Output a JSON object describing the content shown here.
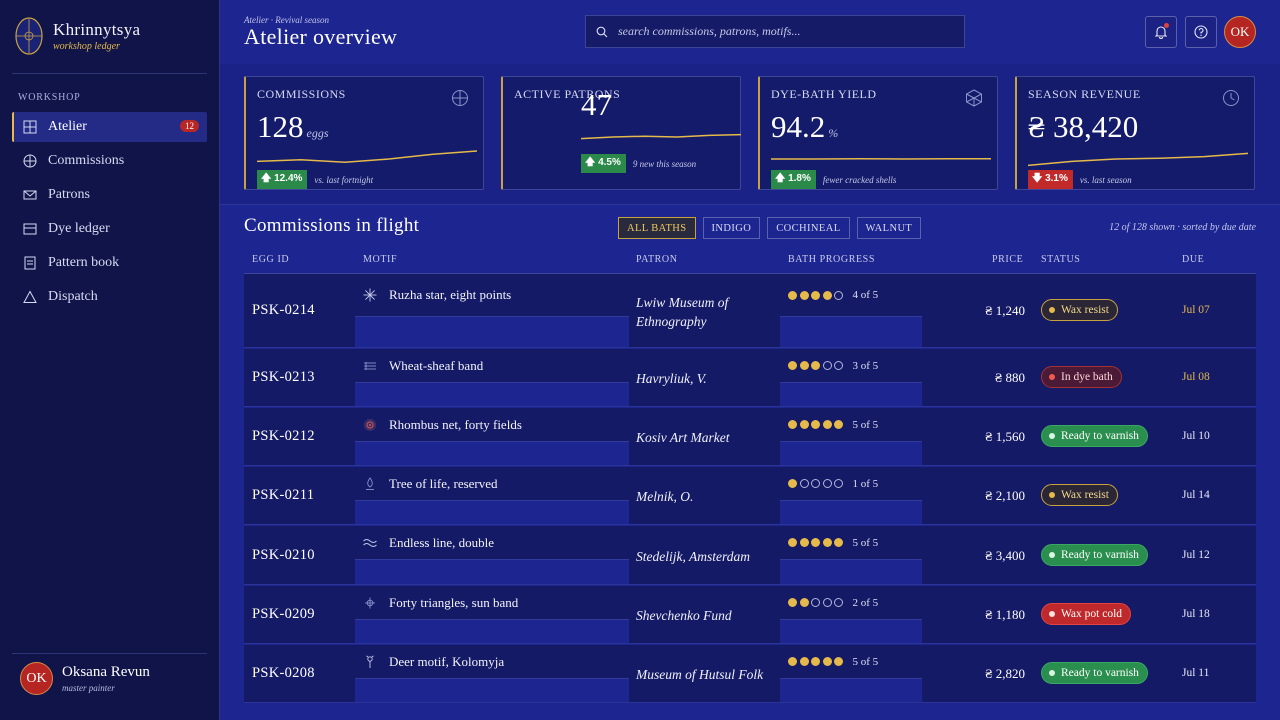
{
  "brand": {
    "name": "Khrinnytsya",
    "subtitle": "workshop ledger"
  },
  "sidebar": {
    "section": "WORKSHOP",
    "items": [
      {
        "label": "Atelier",
        "icon": "grid-icon",
        "badge": "12",
        "active": true
      },
      {
        "label": "Commissions",
        "icon": "compass-icon"
      },
      {
        "label": "Patrons",
        "icon": "envelope-icon"
      },
      {
        "label": "Dye ledger",
        "icon": "ledger-icon"
      },
      {
        "label": "Pattern book",
        "icon": "book-icon"
      },
      {
        "label": "Dispatch",
        "icon": "triangle-icon"
      }
    ]
  },
  "user": {
    "initials": "OK",
    "name": "Oksana Revun",
    "role": "master painter"
  },
  "header": {
    "breadcrumb": "Atelier · Revival season",
    "title": "Atelier overview",
    "search_placeholder": "search commissions, patrons, motifs...",
    "avatar": "OK"
  },
  "kpis": [
    {
      "label": "COMMISSIONS",
      "value": "128",
      "unit": "eggs",
      "delta": "12.4%",
      "direction": "up",
      "note": "vs. last fortnight",
      "icon": "compass-icon",
      "trend": [
        0.35,
        0.45,
        0.3,
        0.5,
        0.8,
        1.0
      ]
    },
    {
      "label": "ACTIVE PATRONS",
      "value": "47",
      "unit": "",
      "delta": "4.5%",
      "direction": "up",
      "note": "9 new this season",
      "icon": "",
      "trend": [
        0.4,
        0.5,
        0.55,
        0.5,
        0.6,
        0.65
      ]
    },
    {
      "label": "DYE-BATH YIELD",
      "value": "94.2",
      "unit": "%",
      "delta": "1.8%",
      "direction": "up",
      "note": "fewer cracked shells",
      "icon": "cube-icon",
      "trend": [
        0.5,
        0.5,
        0.52,
        0.5,
        0.52,
        0.52
      ]
    },
    {
      "label": "SEASON REVENUE",
      "value": "₴ 38,420",
      "unit": "",
      "delta": "3.1%",
      "direction": "down",
      "note": "vs. last season",
      "icon": "clock-icon",
      "trend": [
        0.1,
        0.35,
        0.5,
        0.55,
        0.65,
        0.85
      ]
    }
  ],
  "table": {
    "title": "Commissions in flight",
    "filters": [
      "ALL BATHS",
      "INDIGO",
      "COCHINEAL",
      "WALNUT"
    ],
    "meta": "12 of 128 shown · sorted by due date",
    "columns": [
      "EGG ID",
      "MOTIF",
      "PATRON",
      "BATH PROGRESS",
      "PRICE",
      "STATUS",
      "DUE"
    ],
    "rows": [
      {
        "id": "PSK-0214",
        "motif": "Ruzha star, eight points",
        "motif_icon": "star-icon",
        "patron": "Lwiw Museum of Ethnography",
        "done": 4,
        "progress": "4 of 5",
        "price": "₴ 1,240",
        "status": "Wax resist",
        "status_kind": "wax",
        "due": "Jul 07",
        "due_soon": true
      },
      {
        "id": "PSK-0213",
        "motif": "Wheat-sheaf band",
        "motif_icon": "wheat-icon",
        "patron": "Havryliuk, V.",
        "done": 3,
        "progress": "3 of 5",
        "price": "₴ 880",
        "status": "In dye bath",
        "status_kind": "dye",
        "due": "Jul 08",
        "due_soon": true
      },
      {
        "id": "PSK-0212",
        "motif": "Rhombus net, forty fields",
        "motif_icon": "rhombus-icon",
        "patron": "Kosiv Art Market",
        "done": 5,
        "progress": "5 of 5",
        "price": "₴ 1,560",
        "status": "Ready to varnish",
        "status_kind": "ready",
        "due": "Jul 10",
        "due_soon": false
      },
      {
        "id": "PSK-0211",
        "motif": "Tree of life, reserved",
        "motif_icon": "tree-icon",
        "patron": "Melnik, O.",
        "done": 1,
        "progress": "1 of 5",
        "price": "₴ 2,100",
        "status": "Wax resist",
        "status_kind": "wax",
        "due": "Jul 14",
        "due_soon": false
      },
      {
        "id": "PSK-0210",
        "motif": "Endless line, double",
        "motif_icon": "wave-icon",
        "patron": "Stedelijk, Amsterdam",
        "done": 5,
        "progress": "5 of 5",
        "price": "₴ 3,400",
        "status": "Ready to varnish",
        "status_kind": "ready",
        "due": "Jul 12",
        "due_soon": false
      },
      {
        "id": "PSK-0209",
        "motif": "Forty triangles, sun band",
        "motif_icon": "sun-icon",
        "patron": "Shevchenko Fund",
        "done": 2,
        "progress": "2 of 5",
        "price": "₴ 1,180",
        "status": "Wax pot cold",
        "status_kind": "cold",
        "due": "Jul 18",
        "due_soon": false
      },
      {
        "id": "PSK-0208",
        "motif": "Deer motif, Kolomyja",
        "motif_icon": "deer-icon",
        "patron": "Museum of Hutsul Folk",
        "done": 5,
        "progress": "5 of 5",
        "price": "₴ 2,820",
        "status": "Ready to varnish",
        "status_kind": "ready",
        "due": "Jul 11",
        "due_soon": false
      }
    ]
  },
  "colors": {
    "accent": "#e5b94a",
    "background": "#1d2591",
    "sidebar": "#101449",
    "ready": "#2a8f4e",
    "alert": "#c0292b"
  }
}
